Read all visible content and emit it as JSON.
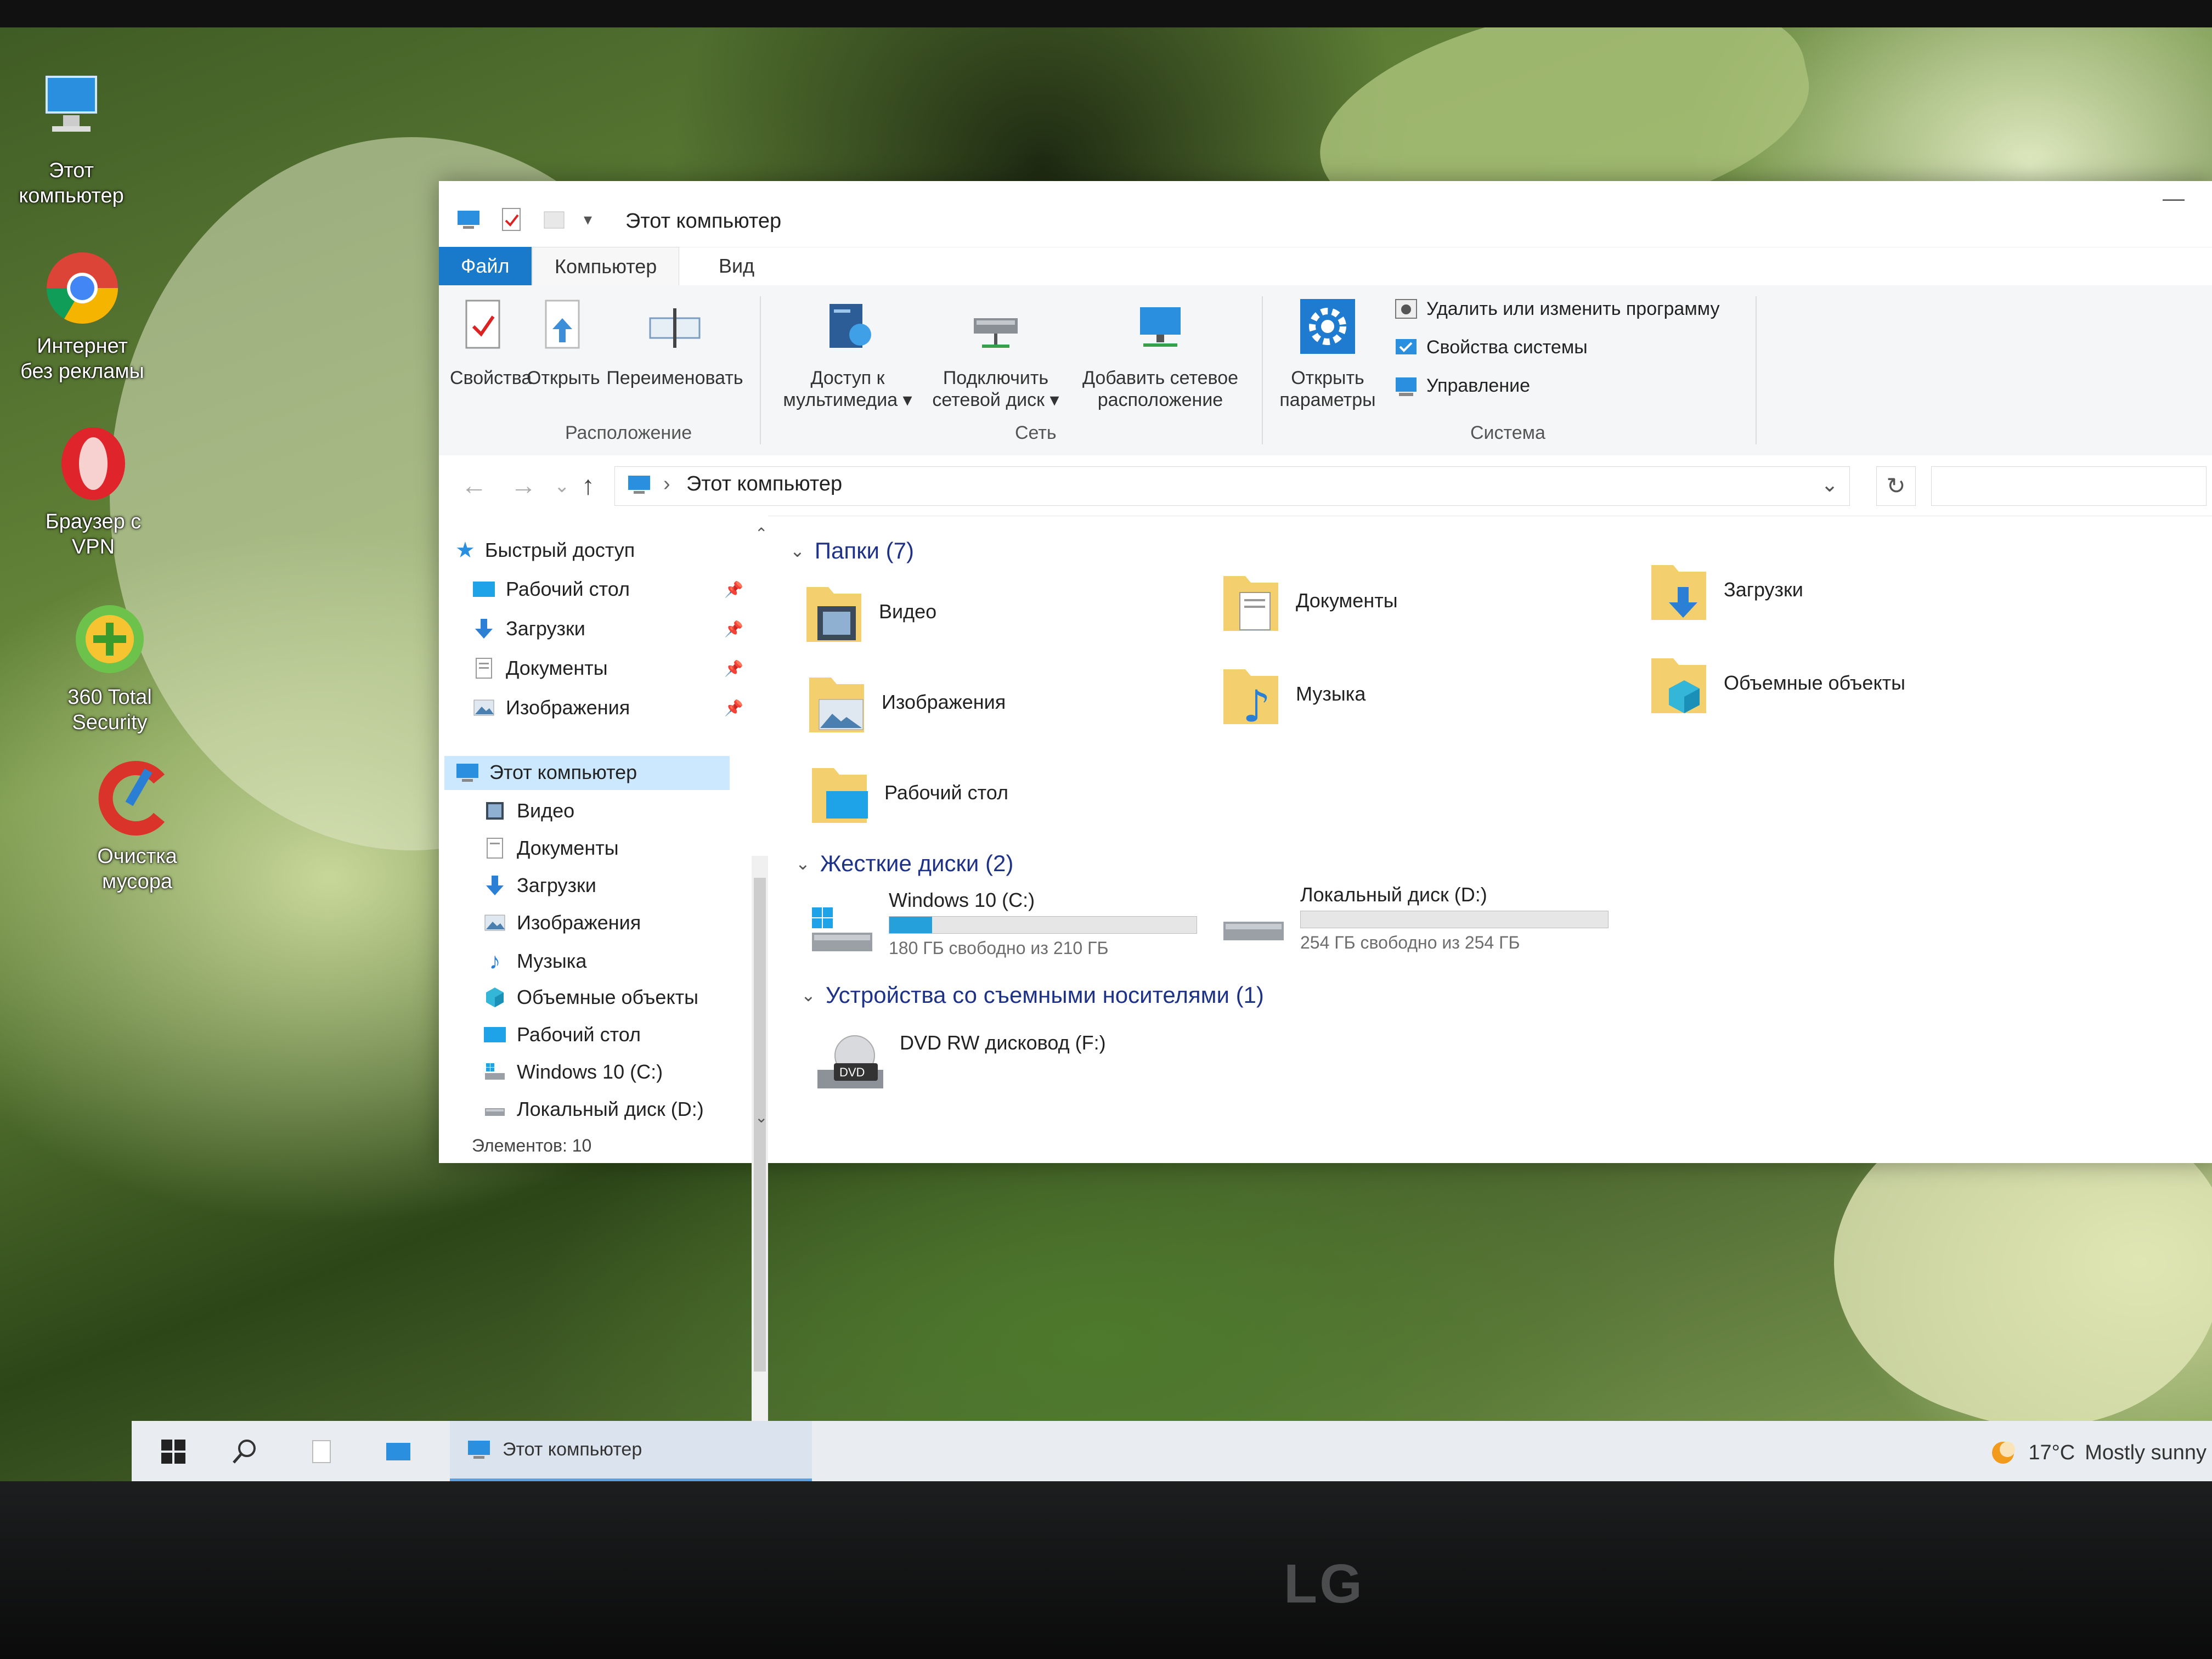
{
  "desktop": {
    "icons": [
      {
        "label": "Этот\nкомпьютер"
      },
      {
        "label": "Интернет\nбез рекламы"
      },
      {
        "label": "Браузер с\nVPN"
      },
      {
        "label": "360 Total\nSecurity"
      },
      {
        "label": "Очистка\nмусора"
      }
    ]
  },
  "window": {
    "title": "Этот компьютер",
    "min_symbol": "—"
  },
  "ribbon": {
    "tabs": {
      "file": "Файл",
      "computer": "Компьютер",
      "view": "Вид"
    },
    "location": {
      "properties": "Свойства",
      "open": "Открыть",
      "rename": "Переименовать",
      "group": "Расположение"
    },
    "network": {
      "media_access": "Доступ к\nмультимедиа ▾",
      "map_drive": "Подключить\nсетевой диск ▾",
      "add_location": "Добавить сетевое\nрасположение",
      "group": "Сеть"
    },
    "system": {
      "open_settings": "Открыть\nпараметры",
      "uninstall": "Удалить или изменить программу",
      "sys_props": "Свойства системы",
      "manage": "Управление",
      "group": "Система"
    }
  },
  "address": {
    "back": "←",
    "forward": "→",
    "recent": "⌄",
    "up": "↑",
    "separator": "›",
    "path": "Этот компьютер",
    "dropdown": "⌄",
    "refresh": "↻"
  },
  "nav": {
    "scroll_up": "⌃",
    "scroll_down": "⌄",
    "pin_symbol": "📌",
    "quick_access": "Быстрый доступ",
    "qa_items": [
      "Рабочий стол",
      "Загрузки",
      "Документы",
      "Изображения"
    ],
    "this_pc": "Этот компьютер",
    "pc_items": [
      "Видео",
      "Документы",
      "Загрузки",
      "Изображения",
      "Музыка",
      "Объемные объекты",
      "Рабочий стол",
      "Windows 10 (C:)",
      "Локальный диск (D:)"
    ],
    "status": "Элементов: 10"
  },
  "content": {
    "chevron": "⌄",
    "folders_header": "Папки (7)",
    "folders": [
      "Видео",
      "Документы",
      "Загрузки",
      "Изображения",
      "Музыка",
      "Объемные объекты",
      "Рабочий стол"
    ],
    "drives_header": "Жесткие диски (2)",
    "drives": [
      {
        "name": "Windows 10 (C:)",
        "free": "180 ГБ свободно из 210 ГБ",
        "used_fraction": 0.14
      },
      {
        "name": "Локальный диск (D:)",
        "free": "254 ГБ свободно из 254 ГБ",
        "used_fraction": 0.0
      }
    ],
    "removable_header": "Устройства со съемными носителями (1)",
    "dvd": {
      "name": "DVD RW дисковод (F:)",
      "tag": "DVD"
    }
  },
  "taskbar": {
    "app_label": "Этот компьютер",
    "weather_temp": "17°C",
    "weather_text": "Mostly sunny"
  },
  "monitor": {
    "brand": "LG"
  },
  "colors": {
    "accent": "#1979ca",
    "progress": "#26a0da",
    "selection": "#cce8ff",
    "header": "#1e3287"
  }
}
